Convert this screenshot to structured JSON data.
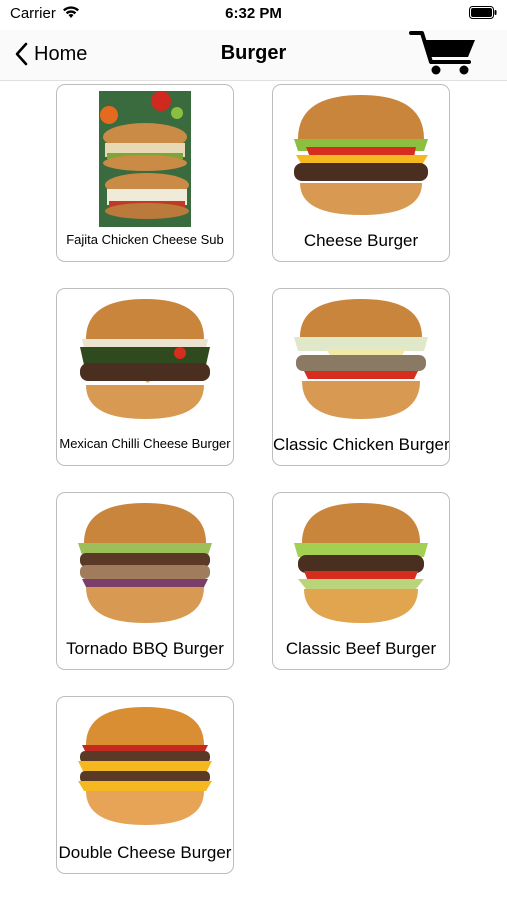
{
  "status_bar": {
    "carrier": "Carrier",
    "time": "6:32 PM"
  },
  "nav": {
    "back_label": "Home",
    "title": "Burger"
  },
  "products": [
    {
      "name": "Fajita Chicken Cheese Sub",
      "image": "sub-sandwich-photo"
    },
    {
      "name": "Cheese Burger",
      "image": "burger-photo"
    },
    {
      "name": "Mexican Chilli Cheese Burger",
      "image": "burger-photo"
    },
    {
      "name": "Classic Chicken Burger",
      "image": "burger-photo"
    },
    {
      "name": "Tornado BBQ Burger",
      "image": "burger-photo"
    },
    {
      "name": "Classic Beef Burger",
      "image": "burger-photo"
    },
    {
      "name": "Double Cheese Burger",
      "image": "burger-photo"
    }
  ]
}
